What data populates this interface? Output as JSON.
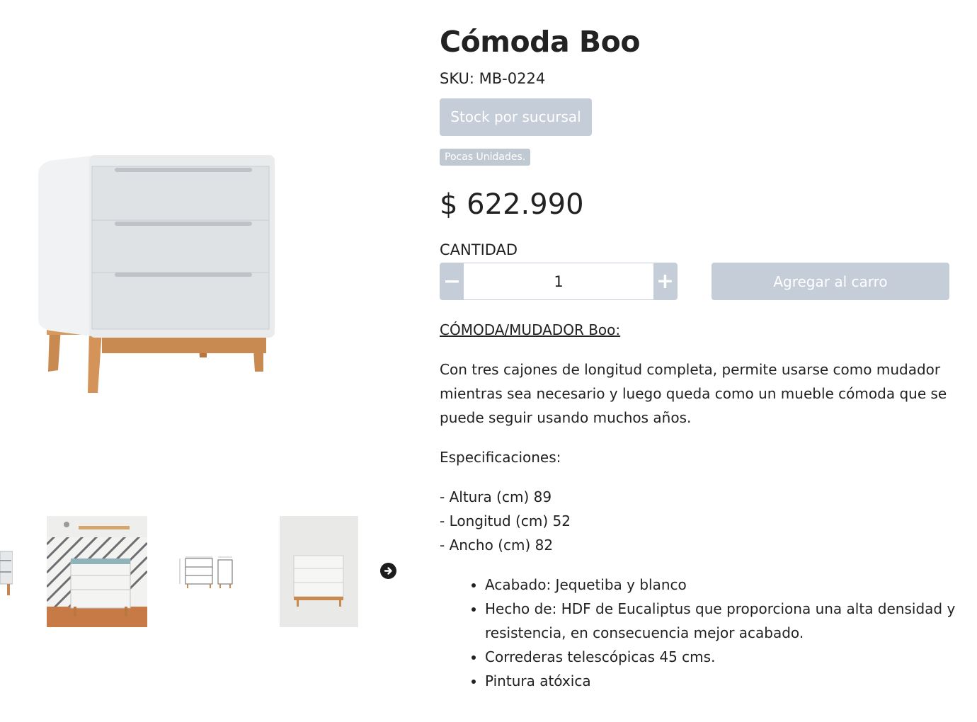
{
  "product": {
    "title": "Cómoda Boo",
    "sku": "SKU: MB-0224",
    "stock_button": "Stock por sucursal",
    "badge": "Pocas Unidades.",
    "price": "$ 622.990"
  },
  "quantity": {
    "label": "CANTIDAD",
    "value": "1",
    "minus": "−",
    "plus": "+"
  },
  "cart": {
    "add_label": "Agregar al carro"
  },
  "description": {
    "heading": "CÓMODA/MUDADOR Boo:",
    "paragraph": "Con tres cajones de longitud completa, permite usarse como mudador mientras sea necesario y luego queda como un mueble cómoda que se puede seguir usando muchos años.",
    "specs_title": "Especificaciones:",
    "spec_lines": [
      "- Altura (cm) 89",
      "- Longitud (cm) 52",
      "- Ancho (cm) 82"
    ],
    "bullets": [
      "Acabado: Jequetiba y blanco",
      "Hecho de: HDF de Eucaliptus que proporciona una alta densidad y resistencia, en consecuencia mejor acabado.",
      "Correderas telescópicas 45 cms.",
      "Pintura atóxica"
    ]
  },
  "gallery": {
    "next_icon": "arrow-right-circle-icon",
    "thumbnail_count": 4
  },
  "colors": {
    "button_disabled": "#c5ced8",
    "text": "#222222"
  }
}
